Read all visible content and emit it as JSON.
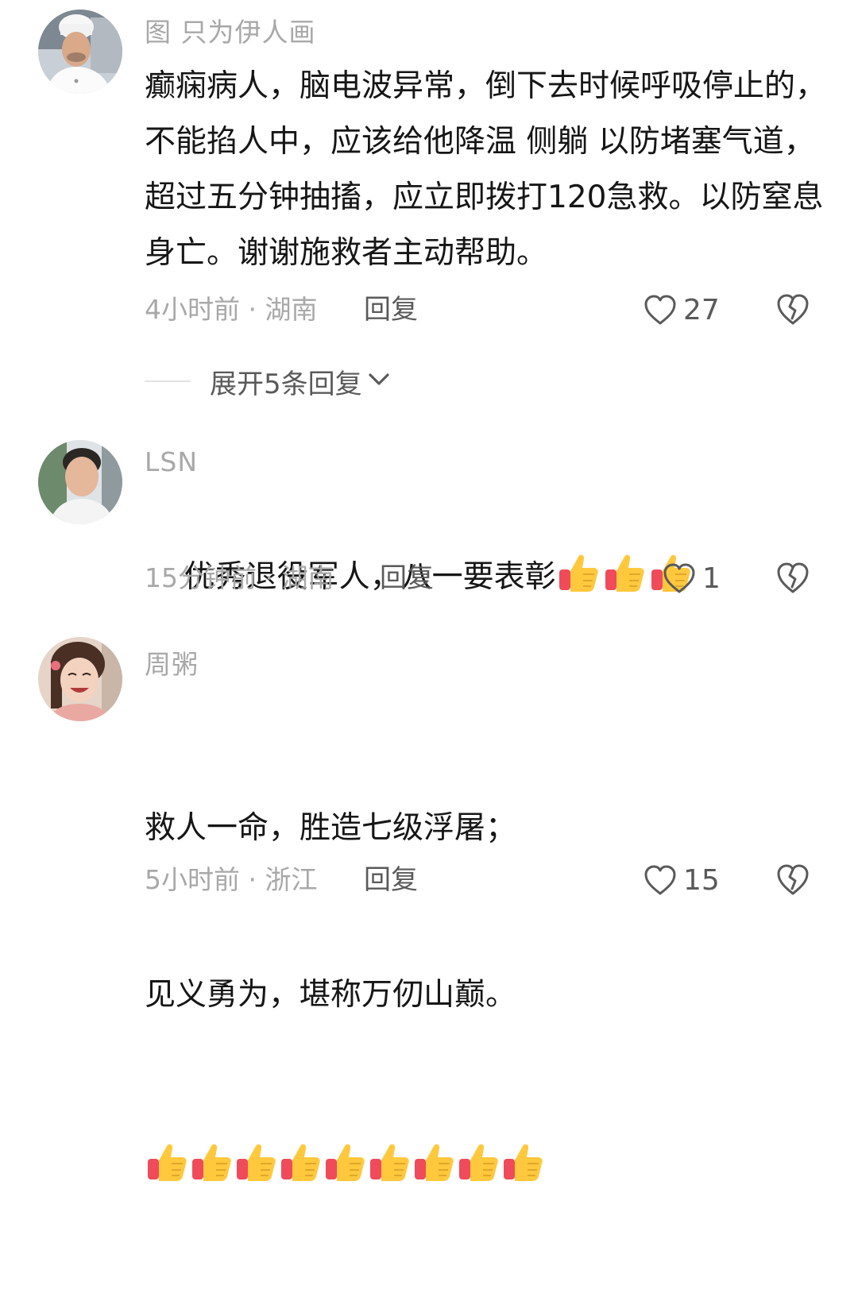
{
  "comments": [
    {
      "username": "图 只为伊人画",
      "text": "癫痫病人，脑电波异常，倒下去时候呼吸停止的，不能掐人中，应该给他降温 侧躺 以防堵塞气道，超过五分钟抽搐，应立即拨打120急救。以防窒息身亡。谢谢施救者主动帮助。",
      "time_location": "4小时前 · 湖南",
      "reply_label": "回复",
      "like_count": "27",
      "avatar": "chef-avatar"
    },
    {
      "username": "LSN",
      "text": "优秀退役军人，八一要表彰",
      "thumbs_count": 3,
      "time_location": "15分钟前 · 湖南",
      "reply_label": "回复",
      "like_count": "1",
      "avatar": "man-avatar"
    },
    {
      "username": "周粥",
      "text_line1": "救人一命，胜造七级浮屠；",
      "text_line2": "见义勇为，堪称万仞山巅。",
      "thumbs_count": 9,
      "time_location": "5小时前 · 浙江",
      "reply_label": "回复",
      "like_count": "15",
      "avatar": "girl-avatar"
    }
  ],
  "expand_replies": {
    "label": "展开5条回复",
    "icon": "chevron-down-icon"
  },
  "icons": {
    "like": "heart-outline-icon",
    "dislike": "broken-heart-icon",
    "thumbs": "thumbs-up-emoji-icon"
  },
  "colors": {
    "text": "#161616",
    "muted": "#a8a8a8",
    "action": "#5a5a5a",
    "thumb_skin": "#ffc83d",
    "thumb_cuff": "#ef4b5a"
  }
}
